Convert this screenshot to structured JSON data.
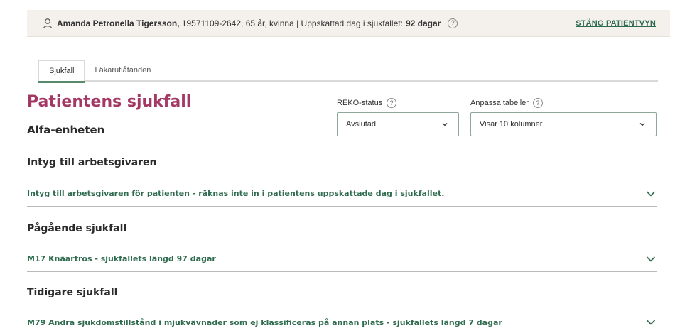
{
  "patient_bar": {
    "name": "Amanda Petronella Tigersson,",
    "info": " 19571109-2642, 65 år, kvinna | Uppskattad dag i sjukfallet:",
    "days": "92 dagar",
    "help_icon_text": "?",
    "close_link": "STÄNG PATIENTVYN"
  },
  "tabs": [
    {
      "label": "Sjukfall",
      "active": true
    },
    {
      "label": "Läkarutlåtanden",
      "active": false
    }
  ],
  "page": {
    "title": "Patientens sjukfall",
    "unit": "Alfa-enheten"
  },
  "filters": {
    "reko": {
      "label": "REKO-status",
      "value": "Avslutad",
      "help": "?"
    },
    "columns": {
      "label": "Anpassa tabeller",
      "value": "Visar 10 kolumner",
      "help": "?"
    }
  },
  "sections": [
    {
      "heading": "Intyg till arbetsgivaren",
      "item": "Intyg till arbetsgivaren för patienten - räknas inte in i patientens uppskattade dag i sjukfallet."
    },
    {
      "heading": "Pågående sjukfall",
      "item": "M17 Knäartros - sjukfallets längd 97 dagar"
    },
    {
      "heading": "Tidigare sjukfall",
      "item": "M79 Andra sjukdomstillstånd i mjukvävnader som ej klassificeras på annan plats - sjukfallets längd 7 dagar"
    }
  ],
  "icons": {
    "person": "person-icon",
    "help": "help-icon",
    "chevron": "chevron-down-icon"
  },
  "colors": {
    "title": "#a33863",
    "link_green": "#2f6b4f",
    "bar_bg": "#f4f1ec"
  }
}
